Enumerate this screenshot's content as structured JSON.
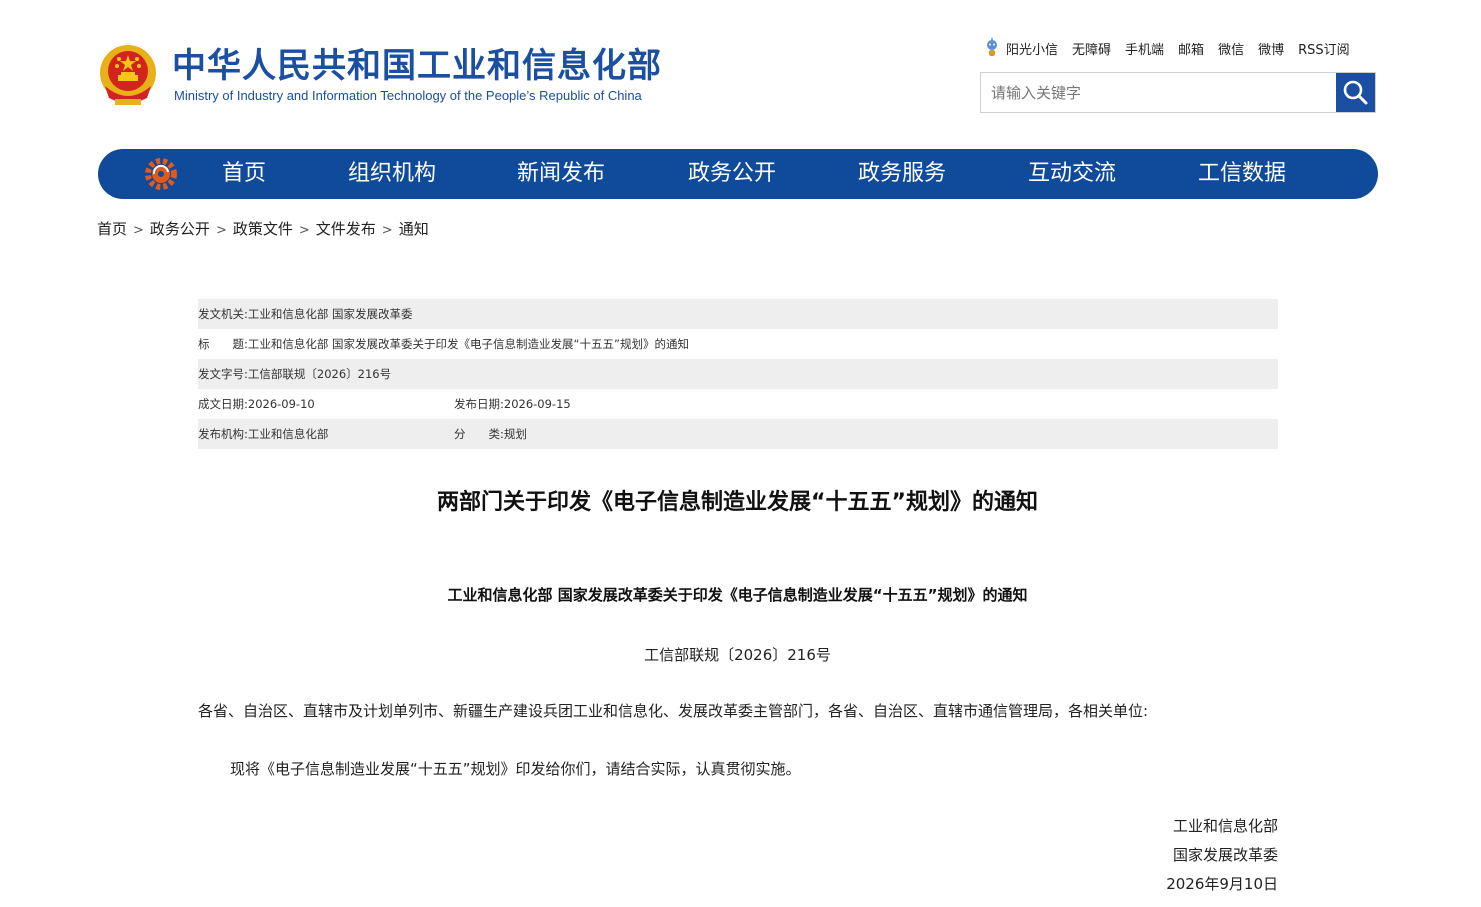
{
  "header": {
    "title": "中华人民共和国工业和信息化部",
    "subtitle": "Ministry of Industry and Information Technology of the People’s Republic of China"
  },
  "toplinks": [
    "阳光小信",
    "无障碍",
    "手机端",
    "邮箱",
    "微信",
    "微博",
    "RSS订阅"
  ],
  "search": {
    "placeholder": "请输入关键字",
    "icon": "search-icon"
  },
  "nav": [
    "首页",
    "组织机构",
    "新闻发布",
    "政务公开",
    "政务服务",
    "互动交流",
    "工信数据"
  ],
  "breadcrumb": [
    "首页",
    "政务公开",
    "政策文件",
    "文件发布",
    "通知"
  ],
  "meta": {
    "issuer_label": "发文机关:",
    "issuer": "工业和信息化部 国家发展改革委",
    "title_label": "标　　题:",
    "title": "工业和信息化部 国家发展改革委关于印发《电子信息制造业发展“十五五”规划》的通知",
    "docno_label": "发文字号:",
    "docno": "工信部联规〔2026〕216号",
    "created_label": "成文日期:",
    "created": "2026-09-10",
    "published_label": "发布日期:",
    "published": "2026-09-15",
    "agency_label": "发布机构:",
    "agency": "工业和信息化部",
    "category_label": "分　　类:",
    "category": "规划"
  },
  "document": {
    "title": "两部门关于印发《电子信息制造业发展“十五五”规划》的通知",
    "heading": "工业和信息化部 国家发展改革委关于印发《电子信息制造业发展“十五五”规划》的通知",
    "number": "工信部联规〔2026〕216号",
    "addressee": "各省、自治区、直辖市及计划单列市、新疆生产建设兵团工业和信息化、发展改革委主管部门，各省、自治区、直辖市通信管理局，各相关单位:",
    "body": "现将《电子信息制造业发展“十五五”规划》印发给你们，请结合实际，认真贯彻实施。",
    "sign1": "工业和信息化部",
    "sign2": "国家发展改革委",
    "date": "2026年9月10日"
  },
  "colors": {
    "brand": "#1a4fa1",
    "nav": "#0f4a9b",
    "meta_shade": "#eeeeee"
  }
}
